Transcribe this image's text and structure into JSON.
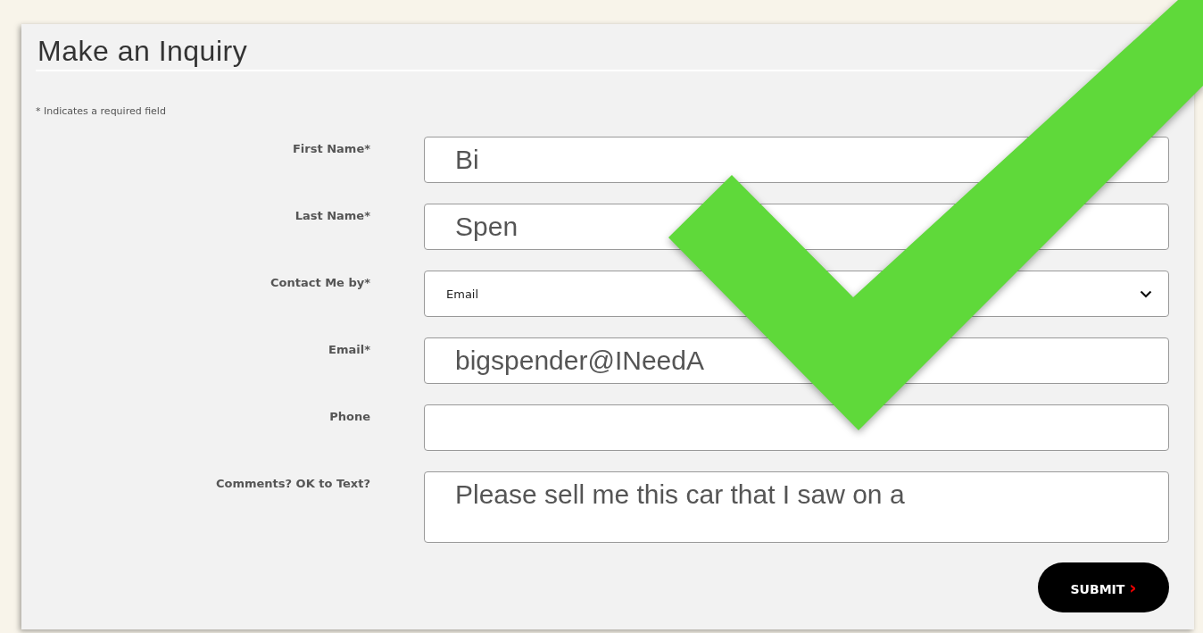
{
  "form": {
    "title": "Make an Inquiry",
    "note": "* Indicates a required field",
    "fields": [
      {
        "kind": "text",
        "label": "First Name*",
        "value": "Bi"
      },
      {
        "kind": "text",
        "label": "Last Name*",
        "value": "Spen"
      },
      {
        "kind": "select",
        "label": "Contact Me by*",
        "value": "Email"
      },
      {
        "kind": "text",
        "label": "Email*",
        "value": "bigspender@INeedA"
      },
      {
        "kind": "text",
        "label": "Phone"
      },
      {
        "kind": "textarea",
        "label": "Comments? OK to Text?",
        "value": "Please sell me this car that I saw on a"
      }
    ],
    "submit": {
      "label": "SUBMIT",
      "arrow": "›"
    }
  }
}
